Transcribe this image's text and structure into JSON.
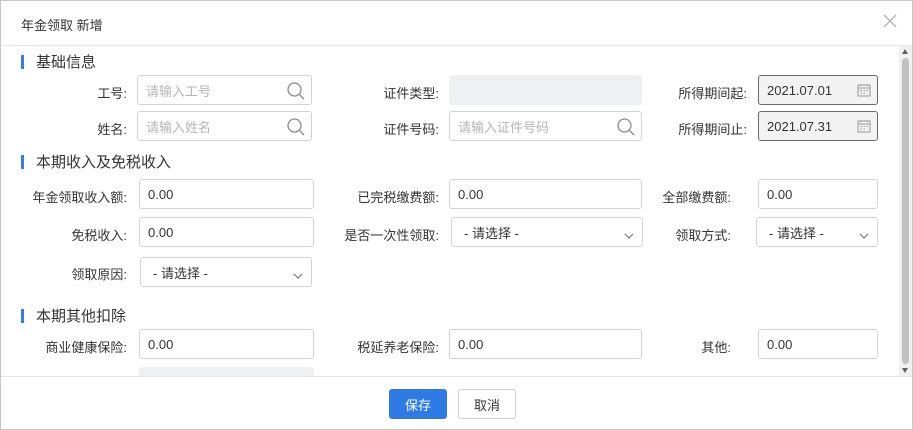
{
  "dialog": {
    "title": "年金领取 新增"
  },
  "sections": {
    "basic": "基础信息",
    "income": "本期收入及免税收入",
    "other": "本期其他扣除"
  },
  "fields": {
    "job_no": {
      "label": "工号:",
      "placeholder": "请输入工号"
    },
    "name": {
      "label": "姓名:",
      "placeholder": "请输入姓名"
    },
    "id_type": {
      "label": "证件类型:",
      "value": ""
    },
    "id_no": {
      "label": "证件号码:",
      "placeholder": "请输入证件号码"
    },
    "period_start": {
      "label": "所得期间起:",
      "value": "2021.07.01"
    },
    "period_end": {
      "label": "所得期间止:",
      "value": "2021.07.31"
    },
    "annuity_income": {
      "label": "年金领取收入额:",
      "value": "0.00"
    },
    "taxed_paid": {
      "label": "已完税缴费额:",
      "value": "0.00"
    },
    "total_paid": {
      "label": "全部缴费额:",
      "value": "0.00"
    },
    "tax_free": {
      "label": "免税收入:",
      "value": "0.00"
    },
    "lump_sum": {
      "label": "是否一次性领取:",
      "value": "- 请选择 -"
    },
    "method": {
      "label": "领取方式:",
      "value": "- 请选择 -"
    },
    "reason": {
      "label": "领取原因:",
      "value": "- 请选择 -"
    },
    "health_ins": {
      "label": "商业健康保险:",
      "value": "0.00"
    },
    "pension_ins": {
      "label": "税延养老保险:",
      "value": "0.00"
    },
    "other": {
      "label": "其他:",
      "value": "0.00"
    }
  },
  "footer": {
    "save": "保存",
    "cancel": "取消"
  },
  "colors": {
    "accent": "#2f7be5",
    "section_bar": "#3a7be0"
  },
  "icons": {
    "close": "close-icon",
    "search": "search-icon",
    "calendar": "calendar-icon",
    "chevron": "chevron-down-icon"
  }
}
